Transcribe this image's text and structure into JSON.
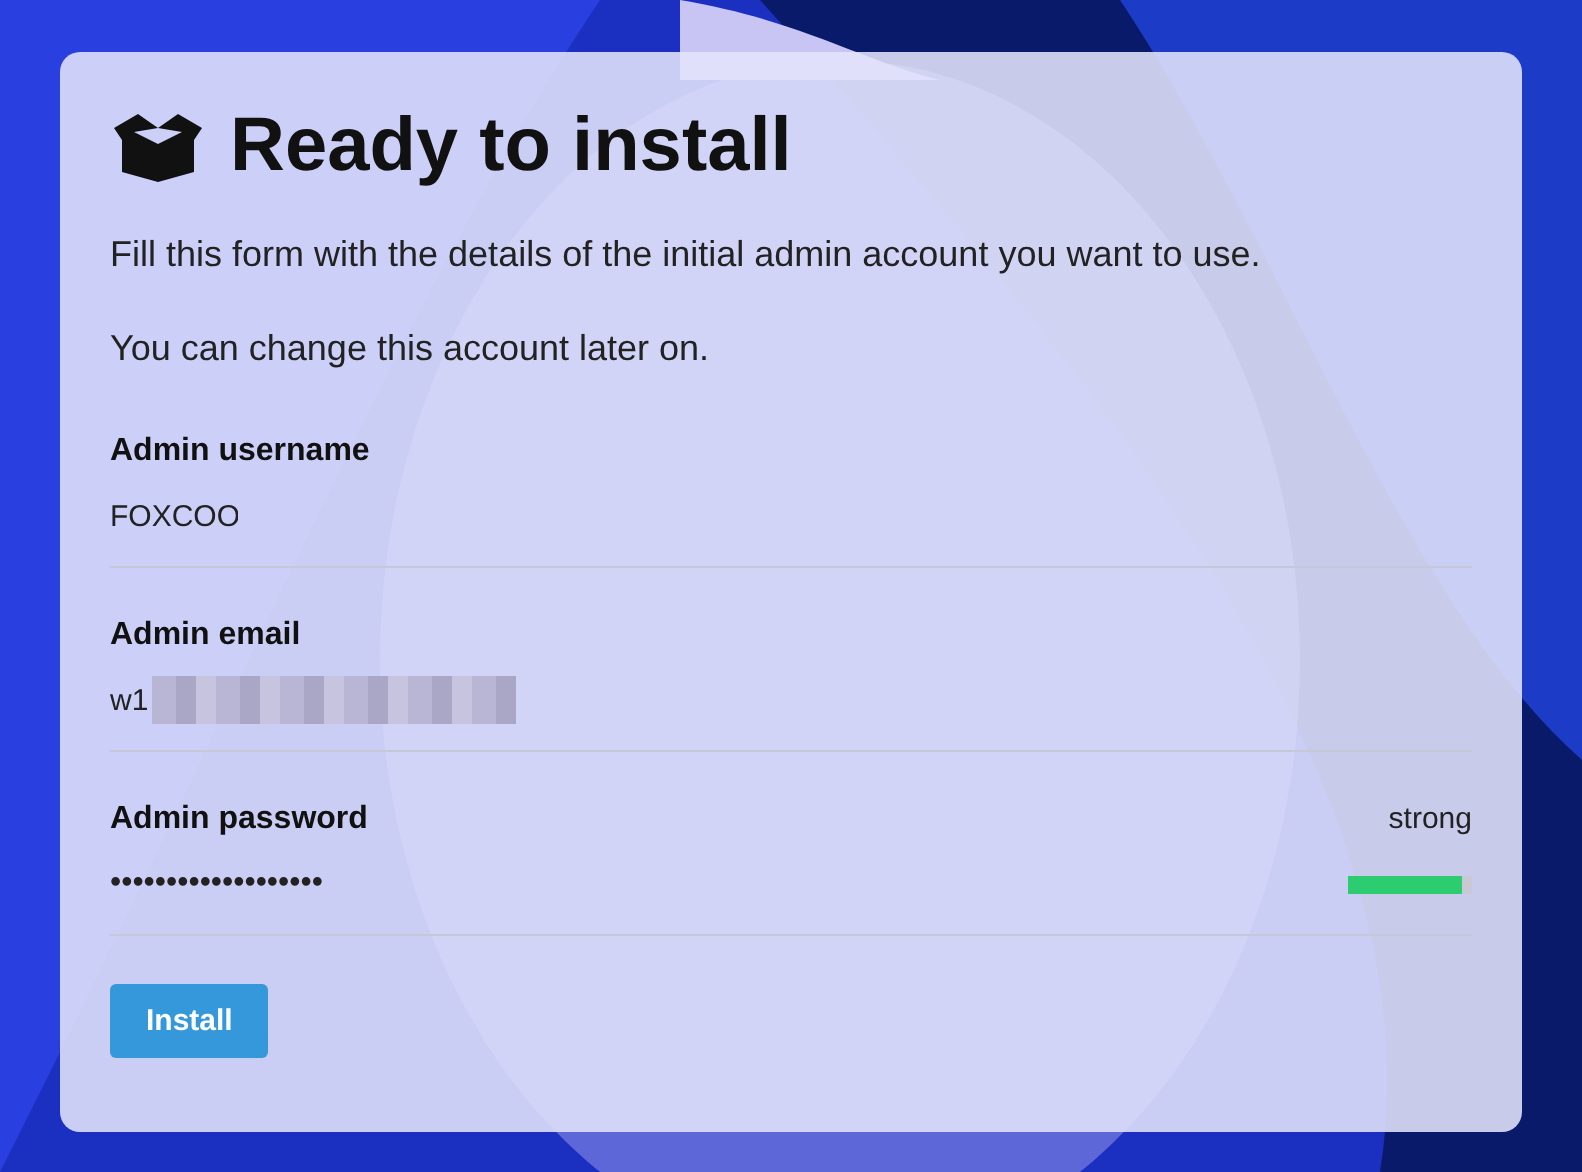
{
  "title": "Ready to install",
  "paragraphs": [
    "Fill this form with the details of the initial admin account you want to use.",
    "You can change this account later on."
  ],
  "fields": [
    {
      "kind": "text",
      "label": "Admin username",
      "value": "FOXCOO",
      "redacted": false
    },
    {
      "kind": "email",
      "label": "Admin email",
      "value": "w1",
      "redacted": true
    },
    {
      "kind": "password",
      "label": "Admin password",
      "value": "•••••••••••••••••••",
      "redacted": false,
      "strength": "strong",
      "level": 0.92
    }
  ],
  "button": "Install"
}
